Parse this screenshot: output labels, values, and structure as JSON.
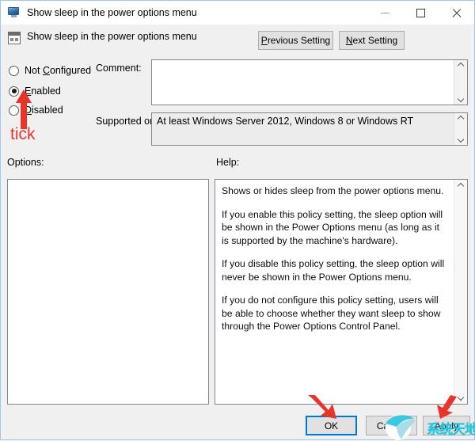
{
  "window": {
    "title": "Show sleep in the power options menu",
    "title_icon": "monitor-icon",
    "minimize_label": "Minimize",
    "maximize_label": "Maximize",
    "close_label": "Close"
  },
  "header": {
    "policy_icon": "policy-window-icon",
    "policy_title": "Show sleep in the power options menu",
    "previous_setting": "Previous Setting",
    "previous_setting_accel": "P",
    "previous_setting_rest": "revious Setting",
    "next_setting": "Next Setting",
    "next_setting_accel": "N",
    "next_setting_rest": "ext Setting"
  },
  "state_options": [
    {
      "id": "not-configured",
      "label": "Not Configured",
      "accel_before": "Not ",
      "accel": "C",
      "accel_after": "onfigured",
      "selected": false
    },
    {
      "id": "enabled",
      "label": "Enabled",
      "accel_before": "",
      "accel": "E",
      "accel_after": "nabled",
      "selected": true
    },
    {
      "id": "disabled",
      "label": "Disabled",
      "accel_before": "",
      "accel": "D",
      "accel_after": "isabled",
      "selected": false
    }
  ],
  "fields": {
    "comment_label": "Comment:",
    "comment_value": "",
    "supported_on_label": "Supported on:",
    "supported_on_value": "At least Windows Server 2012, Windows 8 or Windows RT"
  },
  "sections": {
    "options_label": "Options:",
    "options_content": "",
    "help_label": "Help:"
  },
  "help": {
    "paragraphs": [
      "Shows or hides sleep from the power options menu.",
      "If you enable this policy setting, the sleep option will be shown in the Power Options menu (as long as it is supported by the machine's hardware).",
      "If you disable this policy setting, the sleep option will never be shown in the Power Options menu.",
      "If you do not configure this policy setting, users will be able to choose whether they want sleep to show through the Power Options Control Panel."
    ]
  },
  "buttons": {
    "ok": "OK",
    "cancel": "Cancel",
    "apply": "Apply"
  },
  "annotations": {
    "tick_label": "tick",
    "annotation_color": "#e8352a",
    "arrow_radio_target": "enabled-radio",
    "arrow_ok_target": "ok-button",
    "arrow_apply_target": "apply-button"
  },
  "watermark": {
    "text": "系统天地",
    "color": "#1ec8e0",
    "logo": "swirl-logo"
  },
  "colors": {
    "window_bg": "#f0f0f0",
    "titlebar_bg": "#ffffff",
    "field_bg": "#ffffff",
    "readonly_field_bg": "#ececed",
    "button_bg": "#e1e1e1",
    "button_border": "#adadad",
    "focus_border": "#0078d7",
    "border": "#828790",
    "text": "#000000"
  }
}
